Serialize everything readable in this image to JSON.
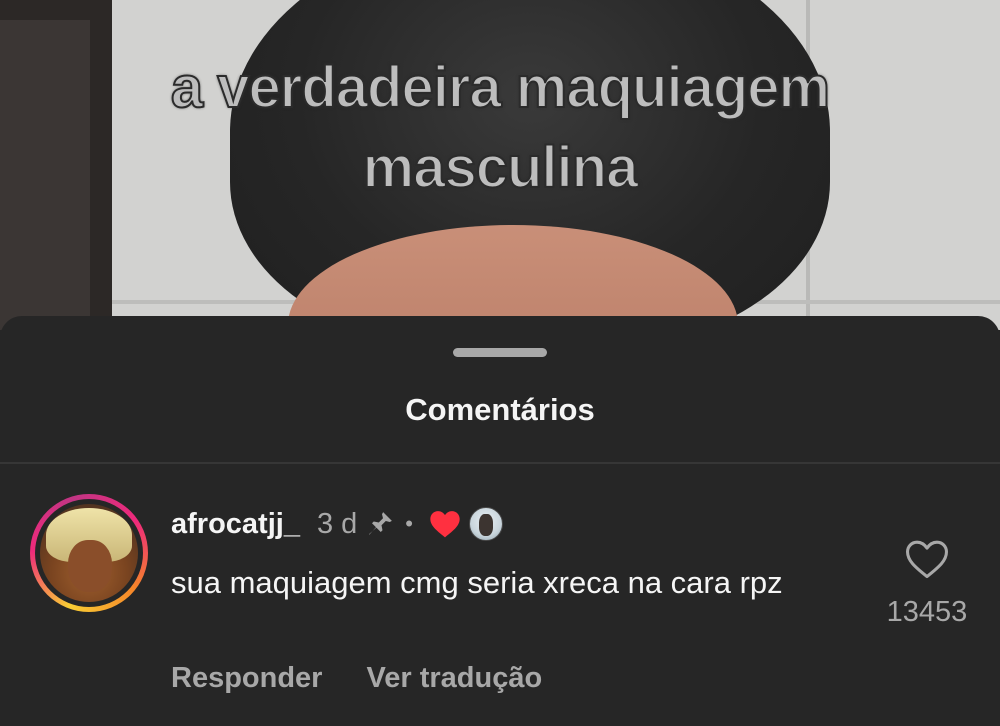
{
  "video": {
    "overlay_line1": "a verdadeira maquiagem",
    "overlay_line2": "masculina"
  },
  "comments_sheet": {
    "title": "Comentários",
    "comment": {
      "username": "afrocatjj_",
      "timestamp": "3 d",
      "separator": "•",
      "text": "sua maquiagem cmg seria xreca na cara rpz",
      "reply_label": "Responder",
      "translate_label": "Ver tradução",
      "like_count": "13453",
      "pinned": true,
      "liked_by_creator": true
    }
  },
  "icons": {
    "pin": "pin-icon",
    "creator_heart": "heart-filled-icon",
    "like": "heart-outline-icon"
  },
  "colors": {
    "sheet_background": "#262626",
    "primary_text": "#f5f5f5",
    "secondary_text": "#a8a8a8",
    "heart_red": "#ff3040"
  }
}
